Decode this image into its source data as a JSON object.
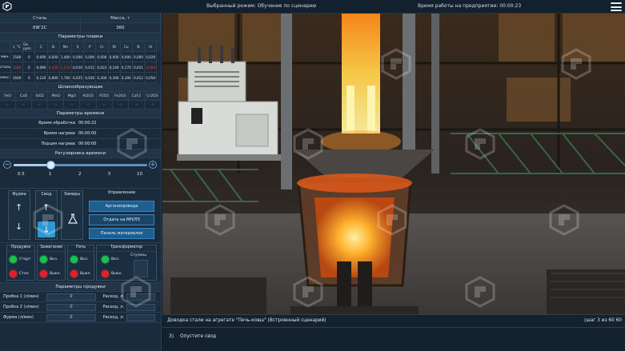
{
  "topbar": {
    "mode": "Выбранный режим: Обучение по сценарию",
    "worktime": "Время работы на предприятии: 00:00:23"
  },
  "steel": {
    "head_steel": "Сталь",
    "head_mass": "Масса, т",
    "steel_val": "09Г2С",
    "mass_val": "360"
  },
  "melt_params": {
    "title": "Параметры плавки",
    "columns": [
      "t, °C",
      "Ок. ppm",
      "C",
      "Si",
      "Mn",
      "S",
      "P",
      "Cr",
      "Ni",
      "Cu",
      "N",
      "Al"
    ],
    "rows": [
      {
        "label": "мин.",
        "values": [
          "1580",
          "0",
          "0,090",
          "0,600",
          "1,400",
          "0,000",
          "0,000",
          "0,000",
          "0,000",
          "0,000",
          "0,000",
          "0,020"
        ]
      },
      {
        "label": "сталь",
        "values": [
          "1580",
          "0",
          "0,090",
          "0,450",
          "1,210",
          "0,010",
          "0,012",
          "0,023",
          "0,140",
          "0,170",
          "0,011",
          "0,000"
        ]
      },
      {
        "label": "макс.",
        "values": [
          "1600",
          "0",
          "0,120",
          "0,800",
          "1,700",
          "0,025",
          "0,030",
          "0,300",
          "0,300",
          "0,300",
          "0,012",
          "0,050"
        ]
      }
    ]
  },
  "slag": {
    "title": "Шлакообразующие",
    "columns": [
      "FeO",
      "CaO",
      "SiO2",
      "MnO",
      "MgO",
      "Al2O3",
      "P2O5",
      "Fe2O3",
      "CaF2",
      "Cr2O3"
    ],
    "values": [
      "-",
      "-",
      "-",
      "-",
      "-",
      "-",
      "-",
      "-",
      "-",
      "-"
    ]
  },
  "time_params": {
    "title": "Параметры времени",
    "rows": [
      {
        "label": "Время обработки",
        "value": "00:00:22"
      },
      {
        "label": "Время нагрева",
        "value": "00:00:00"
      },
      {
        "label": "Порция нагрева",
        "value": "00:00:00"
      }
    ]
  },
  "time_reg": {
    "title": "Регулировка времени",
    "minus": "−",
    "plus": "+",
    "ticks": [
      "0.5",
      "1",
      "2",
      "5",
      "10"
    ],
    "value": 1
  },
  "controls": {
    "fur": "Фурма",
    "svod": "Свод",
    "zamery": "Замеры",
    "mgmt_title": "Управление",
    "btn_argon": "Аргонопровода",
    "btn_mn": "Отдать на МН/ЛЗ",
    "btn_panel": "Панель материалов"
  },
  "status": {
    "prodoovka": "Продувка",
    "zazhiganie": "Зажигание",
    "pech": "Печь",
    "transformer": "Трансформатор",
    "start": "Старт",
    "stop": "Стоп",
    "on": "Вкл.",
    "off": "Выкл.",
    "stupen": "Ступень"
  },
  "blow": {
    "title": "Параметры продувки",
    "rows": [
      {
        "label": "Пробка 1 (л/мин)",
        "value": "0",
        "right": "Расход, л:",
        "rval": ""
      },
      {
        "label": "Пробка 2 (л/мин)",
        "value": "0",
        "right": "Расход, л:",
        "rval": ""
      },
      {
        "label": "Фурма (л/мин)",
        "value": "0",
        "right": "Расход, л:",
        "rval": ""
      }
    ]
  },
  "bottom": {
    "desc": "Доводка стали на агрегате \"Печь-ковш\" (Встроенный сценарий)",
    "step": "(шаг 3 из 60 60",
    "num": "3)",
    "action": "Опустите свод"
  },
  "colors": {
    "accent": "#2f97d6",
    "green": "#19c24b",
    "red": "#e3202a"
  }
}
